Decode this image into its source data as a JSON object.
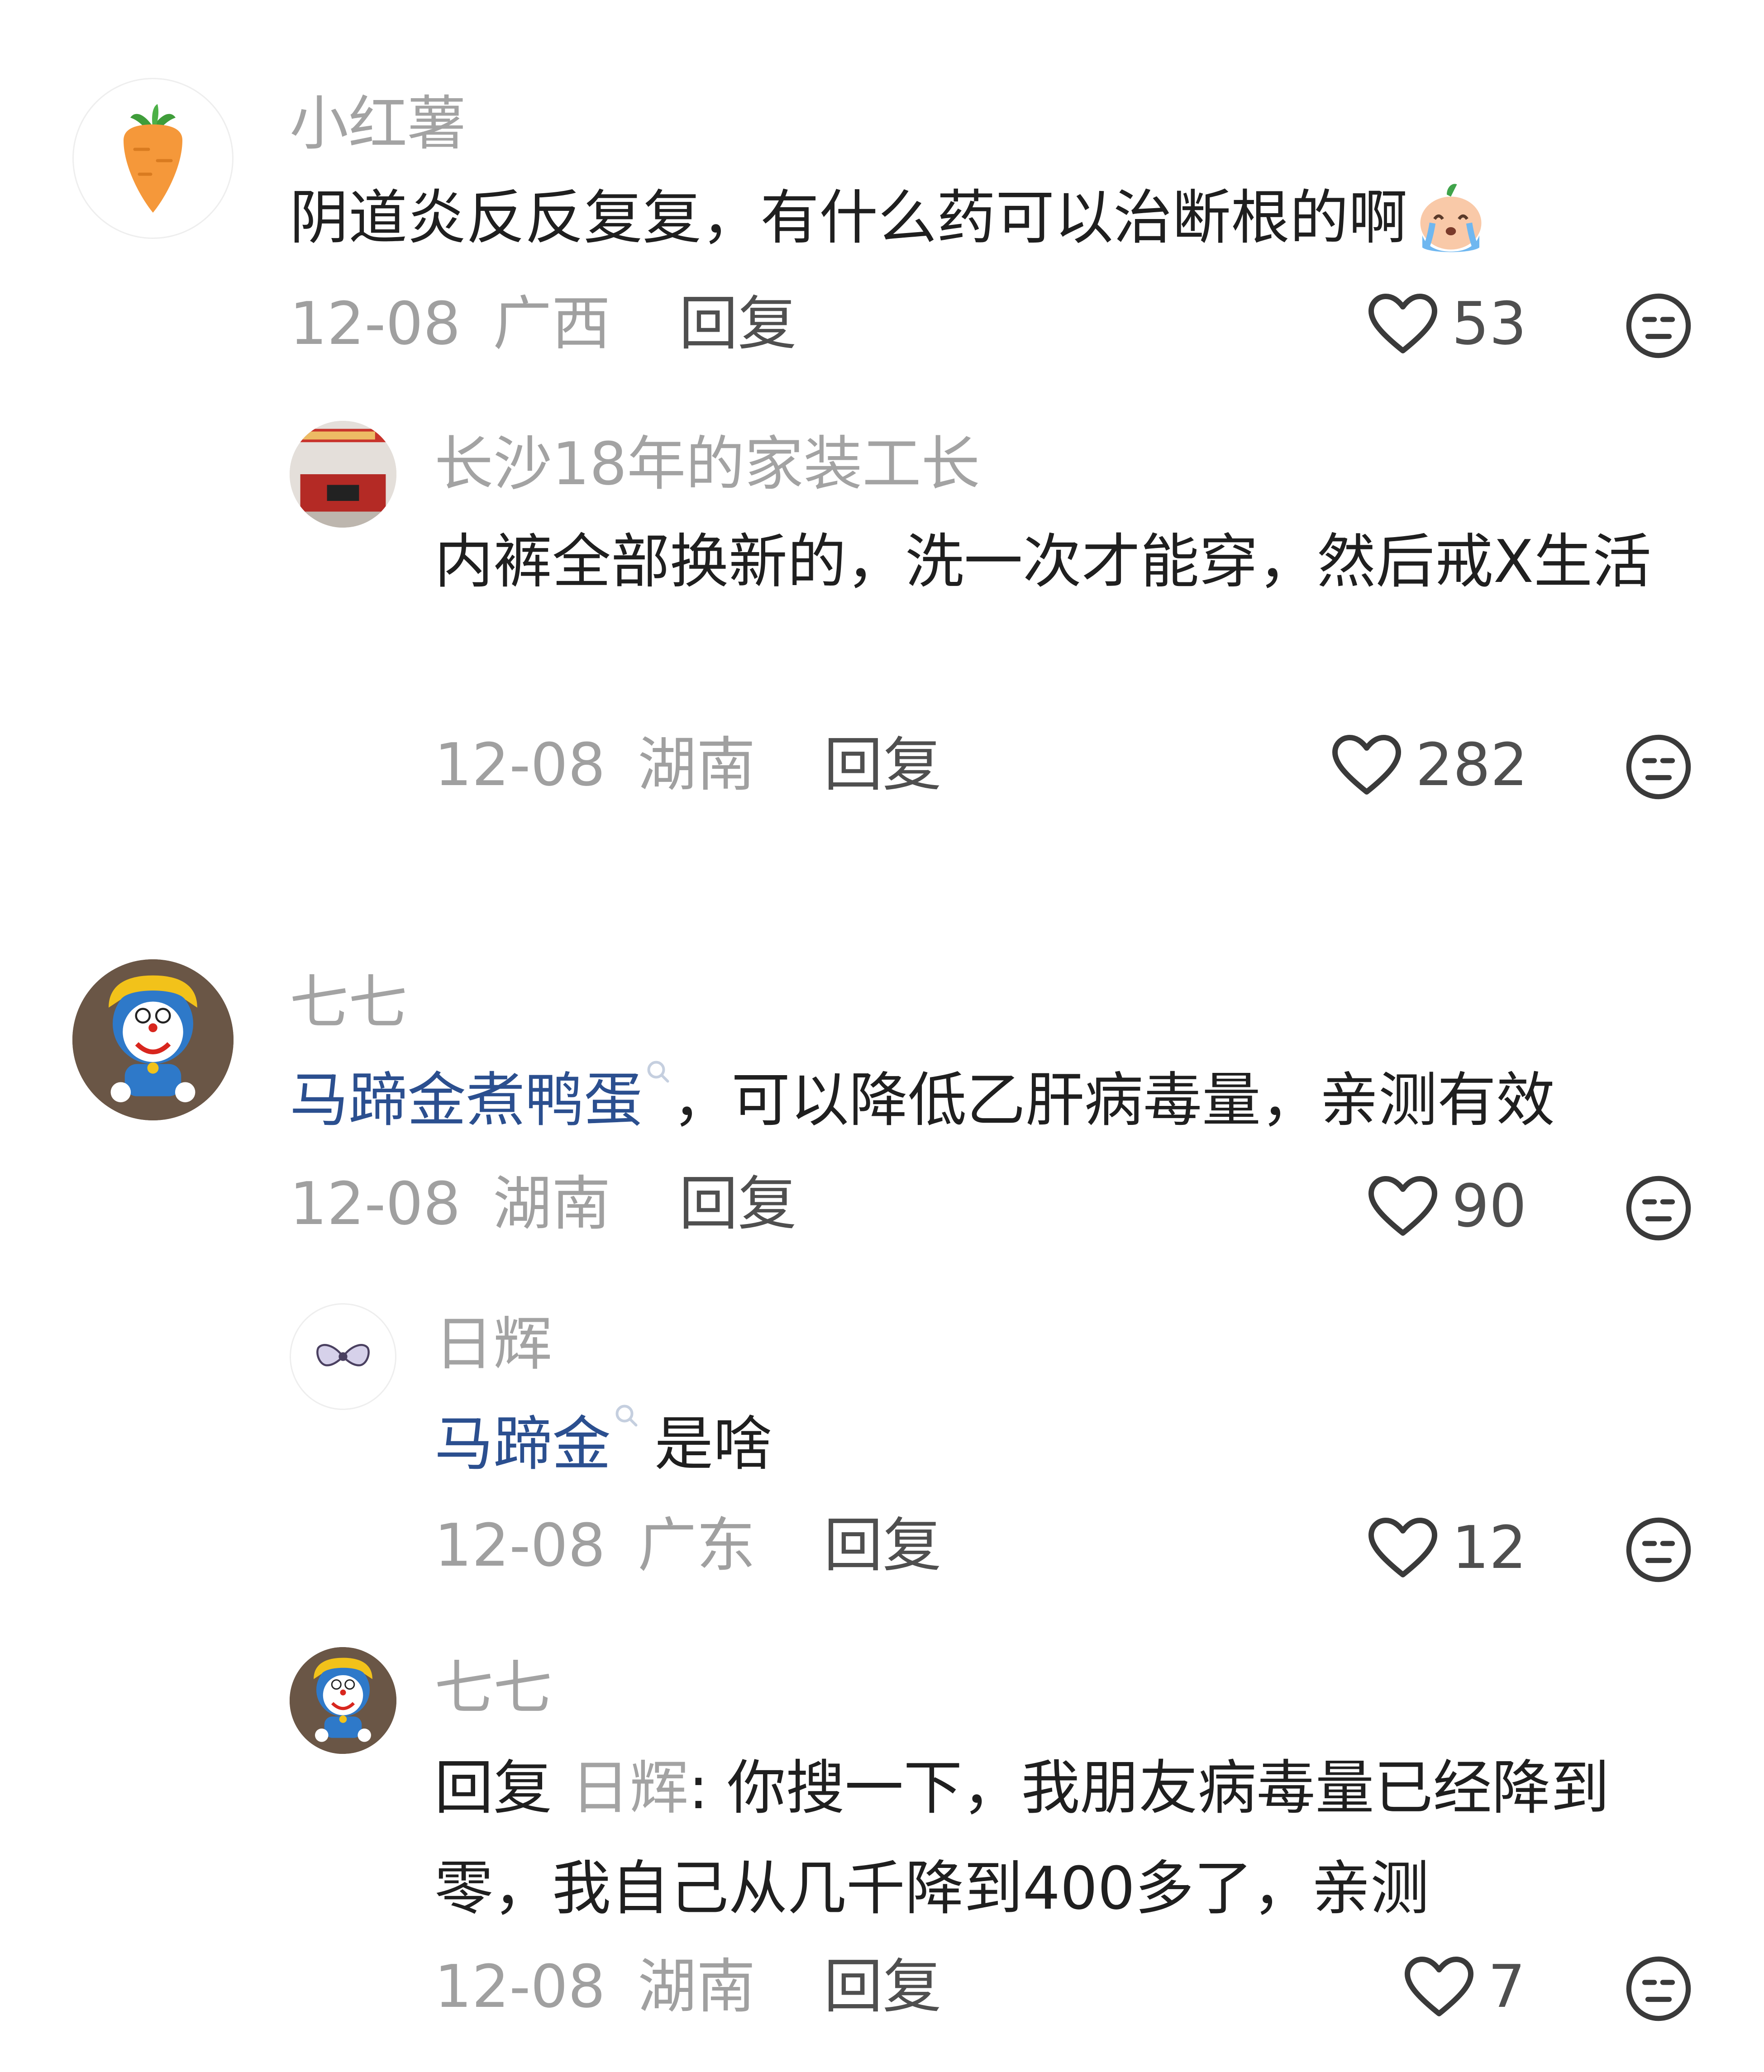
{
  "comments": [
    {
      "user": "小红薯",
      "text": "阴道炎反反复复，有什么药可以治断根的啊",
      "emoji": "crying-face",
      "date": "12-08",
      "location": "广西",
      "reply_label": "回复",
      "likes": "53",
      "avatar": "carrot-icon"
    },
    {
      "user": "长沙18年的家装工长",
      "text": "内裤全部换新的，洗一次才能穿，然后戒X生活",
      "date": "12-08",
      "location": "湖南",
      "reply_label": "回复",
      "likes": "282",
      "avatar": "photo-avatar"
    },
    {
      "user": "七七",
      "link_text": "马蹄金煮鸭蛋",
      "text": "，可以降低乙肝病毒量，亲测有效",
      "date": "12-08",
      "location": "湖南",
      "reply_label": "回复",
      "likes": "90",
      "avatar": "doraemon-avatar"
    },
    {
      "user": "日辉",
      "link_text": "马蹄金",
      "text": "是啥",
      "date": "12-08",
      "location": "广东",
      "reply_label": "回复",
      "likes": "12",
      "avatar": "bow-avatar"
    },
    {
      "user": "七七",
      "reply_prefix": "回复",
      "reply_to": "日辉",
      "text": ": 你搜一下，我朋友病毒量已经降到零，我自己从几千降到400多了，亲测",
      "date": "12-08",
      "location": "湖南",
      "reply_label": "回复",
      "likes": "7",
      "avatar": "doraemon-avatar"
    }
  ],
  "colors": {
    "name": "#a3a3a3",
    "text": "#1f1f1f",
    "link": "#2b4f8f",
    "meta": "#a0a0a0",
    "action": "#4f4f4f"
  }
}
